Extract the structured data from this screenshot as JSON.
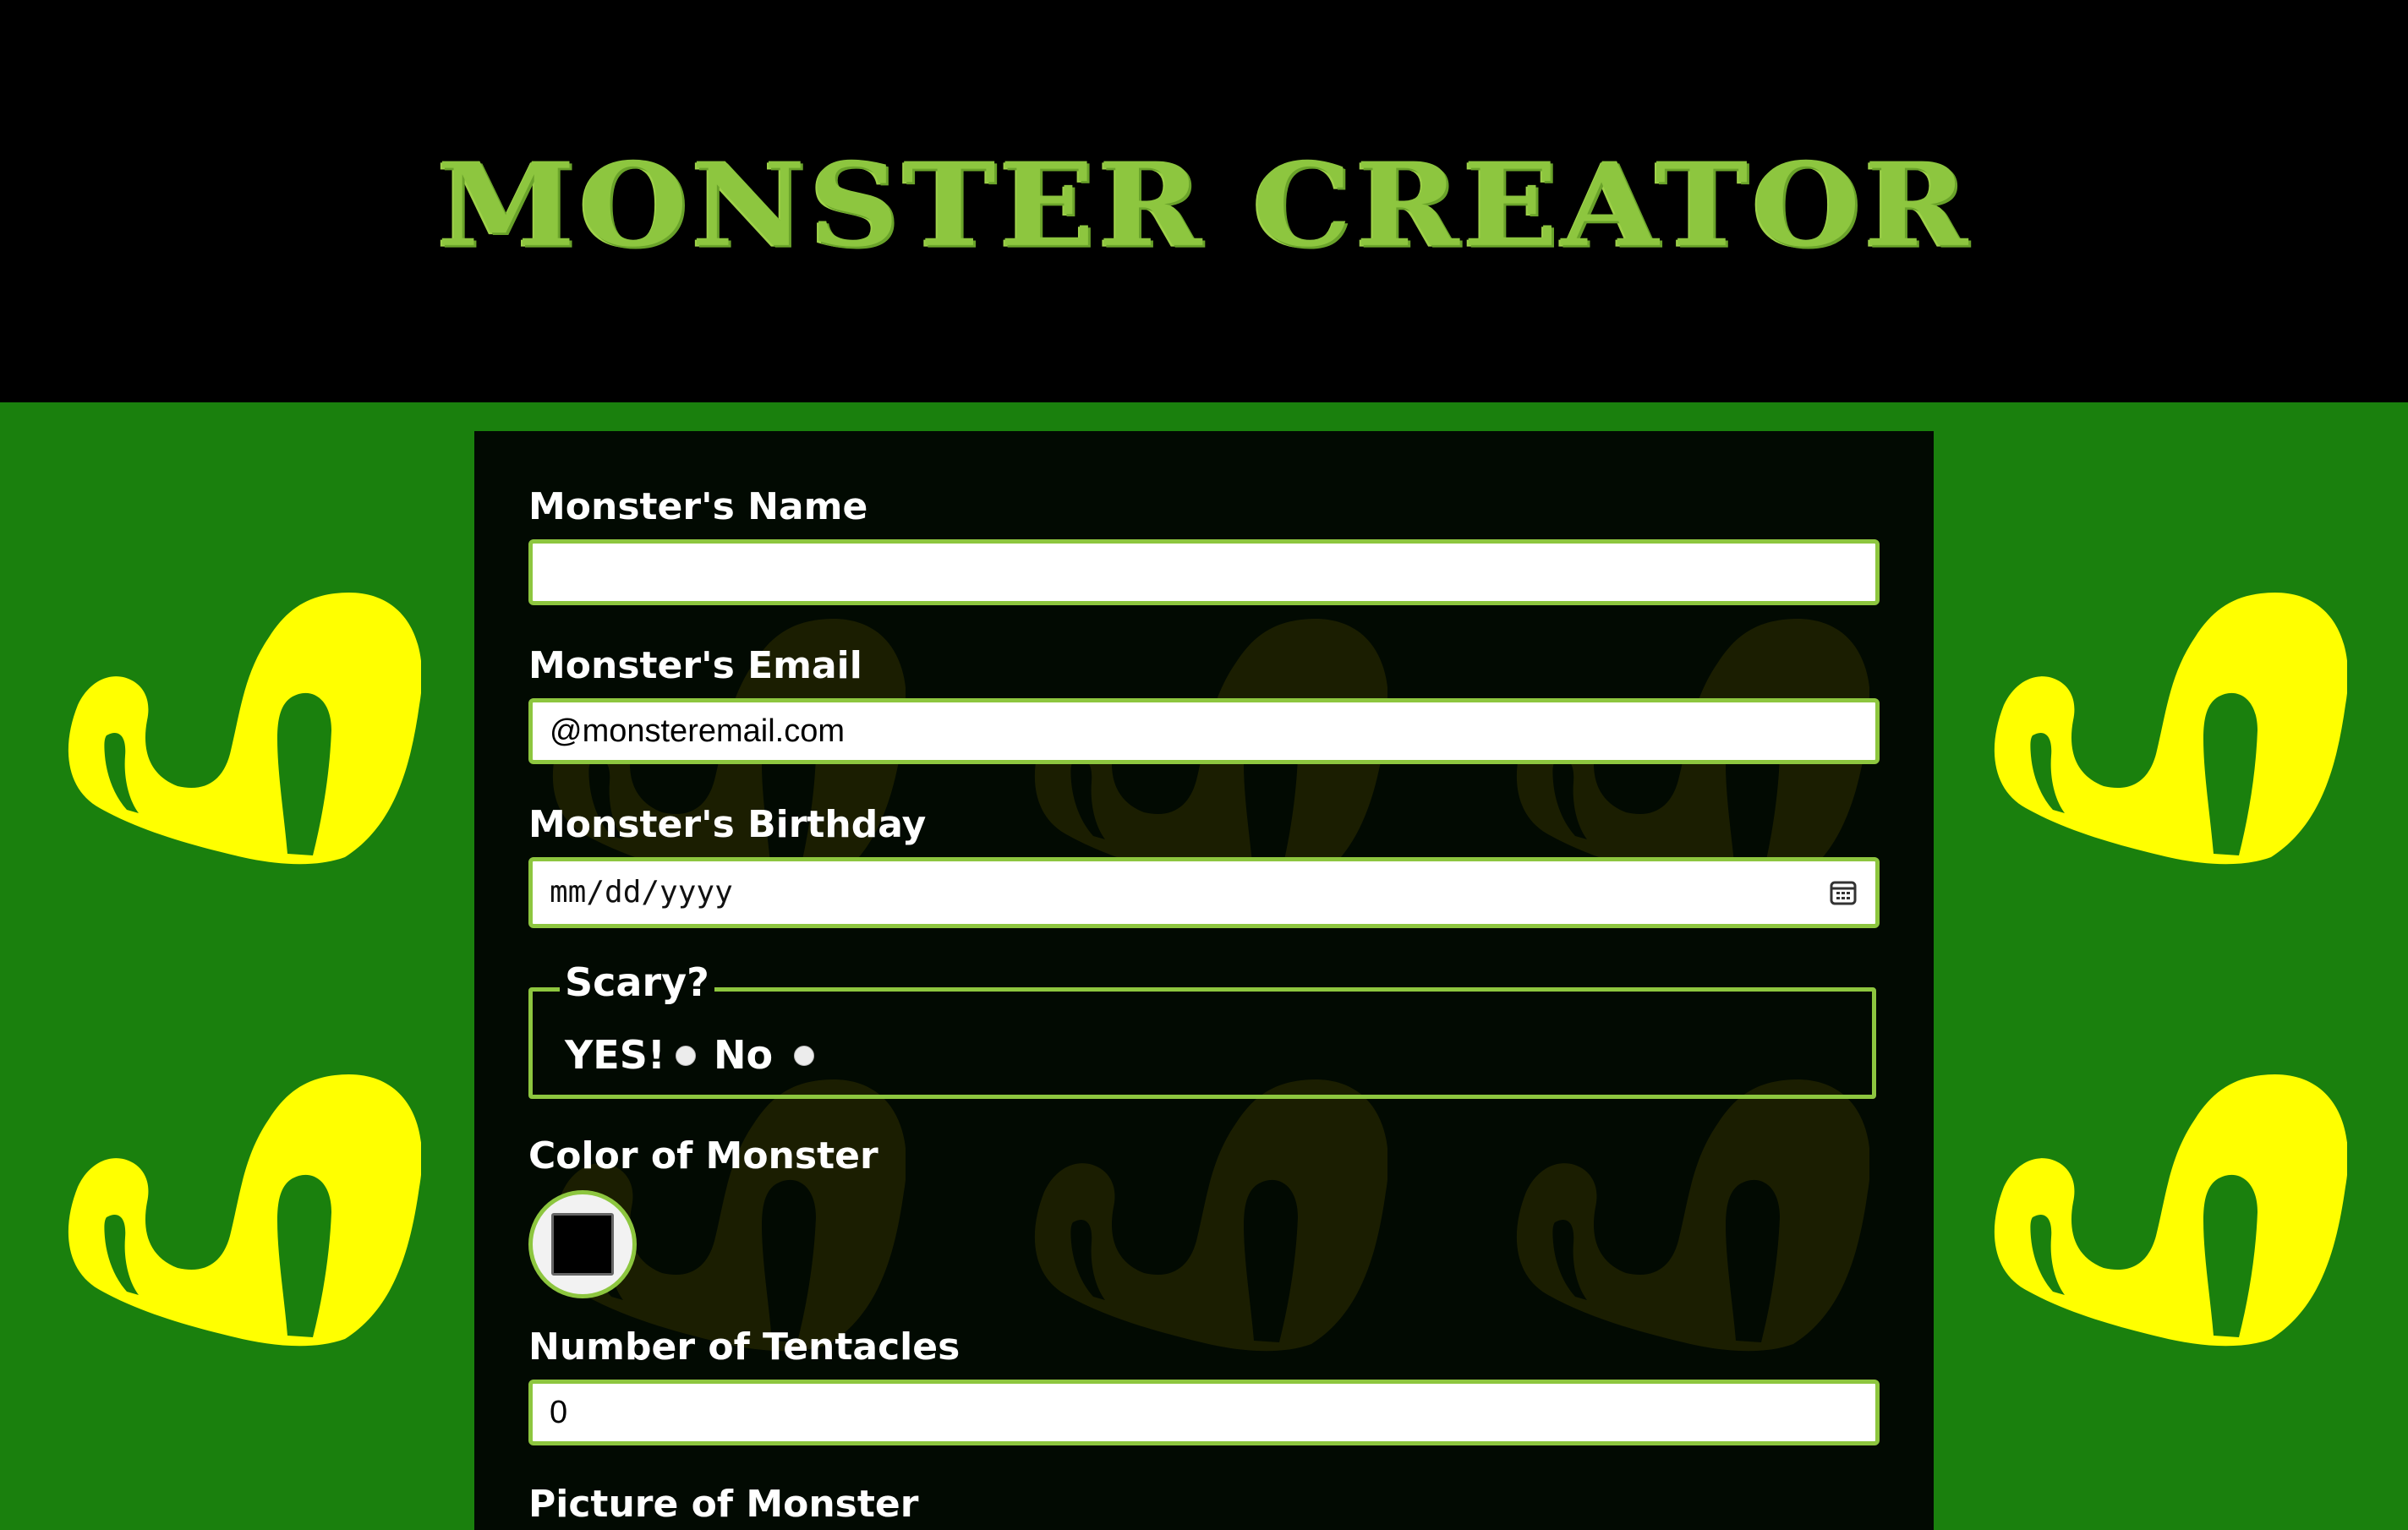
{
  "header": {
    "title": "MONSTER CREATOR"
  },
  "form": {
    "name": {
      "label": "Monster's Name",
      "value": ""
    },
    "email": {
      "label": "Monster's Email",
      "placeholder": "@monsteremail.com"
    },
    "birthday": {
      "label": "Monster's Birthday",
      "placeholder": "mm/dd/yyyy"
    },
    "scary": {
      "legend": "Scary?",
      "options": [
        {
          "label": "YES!"
        },
        {
          "label": "No"
        }
      ]
    },
    "color": {
      "label": "Color of Monster",
      "value": "#000000"
    },
    "tentacles": {
      "label": "Number of Tentacles",
      "value": "0"
    },
    "picture": {
      "label": "Picture of Monster"
    }
  },
  "colors": {
    "header_bg": "#000000",
    "page_bg": "#1a800d",
    "panel_bg": "#020a02",
    "accent": "#8dc63f",
    "monster_yellow": "#ffff00"
  },
  "icons": {
    "side_art": "monster-eye-icon",
    "calendar": "calendar-icon"
  }
}
